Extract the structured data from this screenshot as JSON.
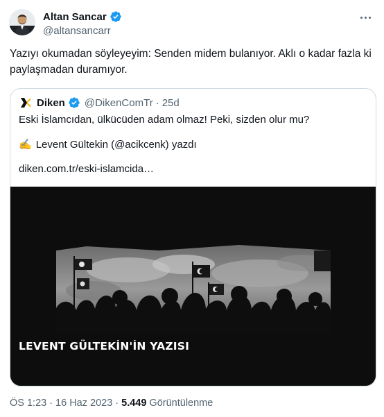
{
  "author": {
    "name": "Altan Sancar",
    "handle": "@altansancarr",
    "verified": true,
    "avatar_icon": "user-avatar"
  },
  "tweet": {
    "text": "Yazıyı okumadan söyleyeyim: Senden midem bulanıyor. Aklı o kadar fazla ki paylaşmadan duramıyor."
  },
  "quote": {
    "name": "Diken",
    "handle": "@DikenComTr",
    "separator": "·",
    "date": "25d",
    "line1": "Eski İslamcıdan, ülkücüden adam olmaz! Peki, sizden olur mu?",
    "pen_icon": "✍️",
    "line2": "Levent Gültekin (@acikcenk) yazdı",
    "line3": "diken.com.tr/eski-islamcida…",
    "image_caption": "LEVENT GÜLTEKİN'İN YAZISI"
  },
  "meta": {
    "time": "ÖS 1:23",
    "separator": "·",
    "date": "16 Haz 2023",
    "views_count": "5.449",
    "views_label": "Görüntülenme"
  },
  "colors": {
    "accent": "#1d9bf0",
    "secondary_text": "#536471",
    "border": "#cfd9de",
    "diken_logo": "#f7b500"
  }
}
